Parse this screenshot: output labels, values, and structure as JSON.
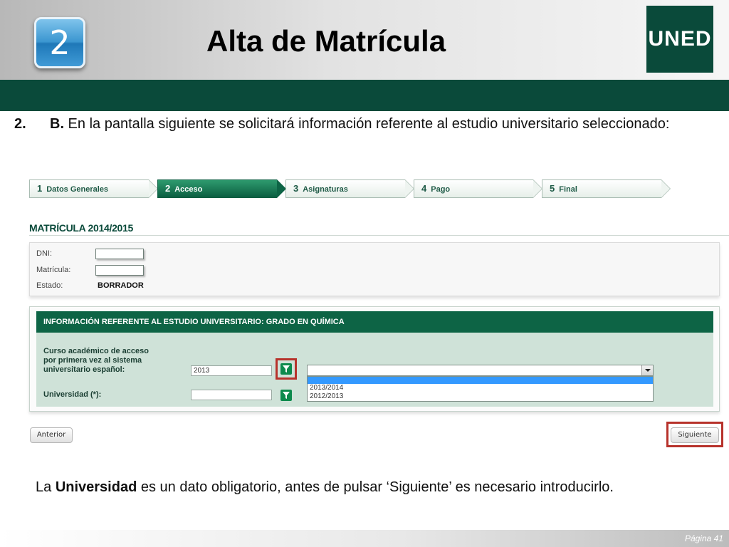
{
  "slide": {
    "step_number": "2",
    "title": "Alta de Matrícula",
    "logo_text": "UNED",
    "page_label": "Página 41"
  },
  "instruction": {
    "number": "2.",
    "letter": "B.",
    "text": " En la pantalla siguiente se solicitará información referente al estudio universitario seleccionado:"
  },
  "wizard": {
    "steps": [
      {
        "num": "1",
        "label": "Datos Generales",
        "active": false
      },
      {
        "num": "2",
        "label": "Acceso",
        "active": true
      },
      {
        "num": "3",
        "label": "Asignaturas",
        "active": false
      },
      {
        "num": "4",
        "label": "Pago",
        "active": false
      },
      {
        "num": "5",
        "label": "Final",
        "active": false
      }
    ]
  },
  "form": {
    "title": "MATRÍCULA 2014/2015",
    "dni_label": "DNI:",
    "dni_value": "",
    "matricula_label": "Matrícula:",
    "matricula_value": "",
    "estado_label": "Estado:",
    "estado_value": "BORRADOR"
  },
  "study_panel": {
    "header": "INFORMACIÓN REFERENTE AL ESTUDIO UNIVERSITARIO: GRADO EN QUÍMICA",
    "curso_label_1": "Curso académico de acceso",
    "curso_label_2": "por primera vez al sistema",
    "curso_label_3": "universitario español:",
    "curso_value": "2013",
    "universidad_label": "Universidad (*):",
    "universidad_value": "",
    "dropdown_selected": "",
    "dropdown_options": [
      "2013/2014",
      "2012/2013"
    ]
  },
  "nav": {
    "prev_label": "Anterior",
    "next_label": "Siguiente"
  },
  "note": {
    "before": "La ",
    "bold": "Universidad",
    "after": " es un dato obligatorio, antes de pulsar ‘Siguiente’ es necesario introducirlo."
  },
  "colors": {
    "brand_green": "#0a4a3a",
    "highlight_red": "#b7322b",
    "dropdown_selection": "#3399ff"
  }
}
